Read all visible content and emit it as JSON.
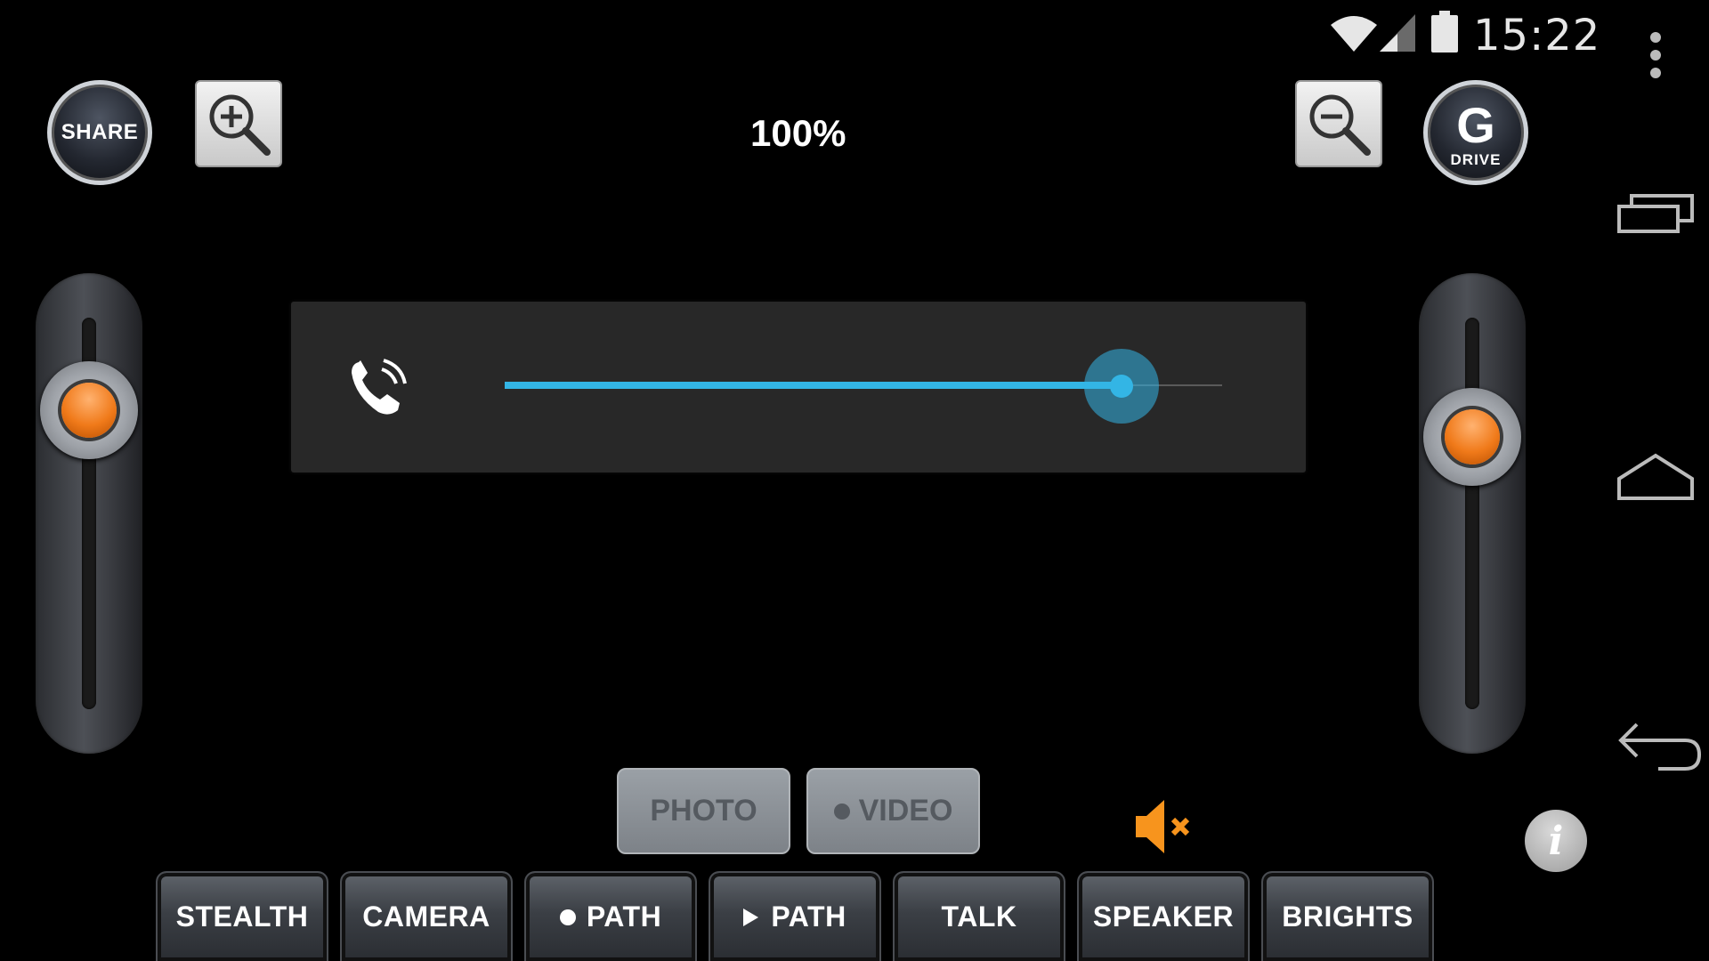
{
  "status_bar": {
    "time": "15:22",
    "icons": [
      "wifi-icon",
      "signal-icon",
      "battery-icon"
    ]
  },
  "header": {
    "share_label": "SHARE",
    "zoom_level": "100%",
    "drive_letter": "G",
    "drive_label": "DRIVE"
  },
  "volume_dialog": {
    "stream_icon": "phone-ringing-icon",
    "level": 0.86
  },
  "sliders": {
    "left_level": 0.77,
    "right_level": 0.7
  },
  "capture": {
    "photo_label": "PHOTO",
    "video_label": "VIDEO"
  },
  "bottom_bar": {
    "stealth": "STEALTH",
    "camera": "CAMERA",
    "record_path": "PATH",
    "play_path": "PATH",
    "talk": "TALK",
    "speaker": "SPEAKER",
    "brights": "BRIGHTS"
  },
  "colors": {
    "accent": "#33b5e5",
    "knob": "#f07a1a",
    "mute": "#f7941d"
  }
}
